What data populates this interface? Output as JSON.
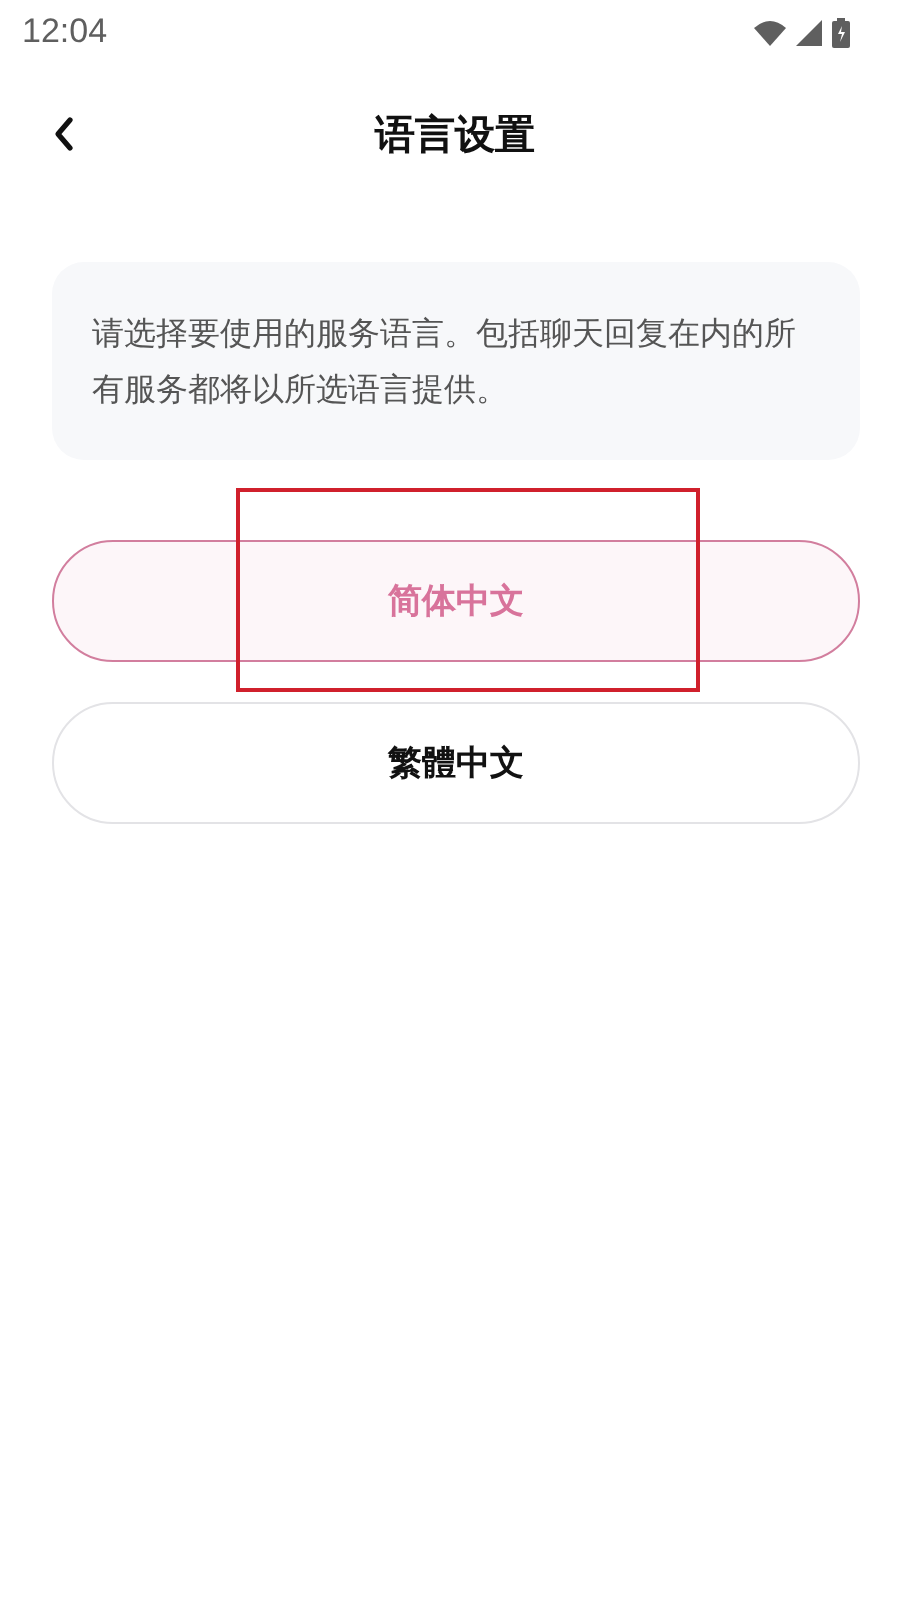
{
  "status_bar": {
    "time": "12:04"
  },
  "header": {
    "title": "语言设置"
  },
  "notice": "请选择要使用的服务语言。包括聊天回复在内的所有服务都将以所选语言提供。",
  "options": [
    {
      "label": "简体中文",
      "selected": true,
      "highlighted": true
    },
    {
      "label": "繁體中文",
      "selected": false,
      "highlighted": false
    }
  ]
}
